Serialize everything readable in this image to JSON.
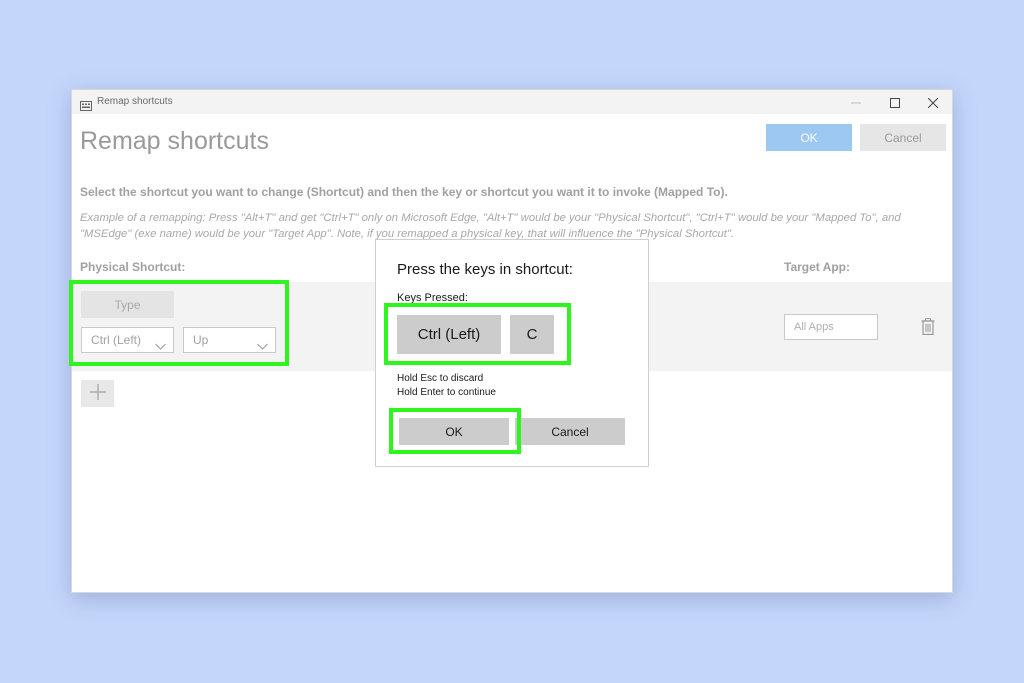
{
  "window": {
    "title": "Remap shortcuts",
    "minimize_icon": "minimize-icon",
    "maximize_icon": "maximize-icon",
    "close_icon": "close-icon"
  },
  "header": {
    "page_title": "Remap shortcuts",
    "ok_label": "OK",
    "cancel_label": "Cancel"
  },
  "instructions": {
    "main": "Select the shortcut you want to change (Shortcut) and then the key or shortcut you want it to invoke (Mapped To).",
    "example": "Example of a remapping: Press \"Alt+T\" and get \"Ctrl+T\" only on Microsoft Edge, \"Alt+T\" would be your \"Physical Shortcut\", \"Ctrl+T\" would be your \"Mapped To\", and \"MSEdge\" (exe name) would be your \"Target App\". Note, if you remapped a physical key, that will influence the \"Physical Shortcut\"."
  },
  "columns": {
    "physical": "Physical Shortcut:",
    "target": "Target App:"
  },
  "row": {
    "type_label": "Type",
    "modifier_selected": "Ctrl (Left)",
    "key_selected": "Up",
    "target_placeholder": "All Apps"
  },
  "dialog": {
    "title": "Press the keys in shortcut:",
    "keys_label": "Keys Pressed:",
    "keys": [
      "Ctrl (Left)",
      "C"
    ],
    "hint_discard": "Hold Esc to discard",
    "hint_continue": "Hold Enter to continue",
    "ok_label": "OK",
    "cancel_label": "Cancel"
  },
  "colors": {
    "background": "#c5d6fb",
    "highlight": "#2ef51e",
    "primary_button": "#9cc8f1"
  }
}
